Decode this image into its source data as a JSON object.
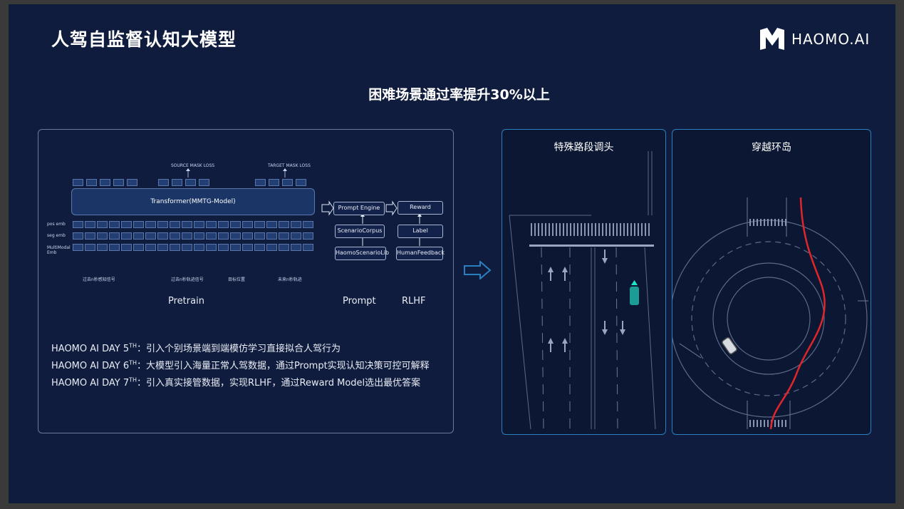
{
  "title": "人驾自监督认知大模型",
  "logo": {
    "text": "HAOMO.AI",
    "icon": "haomo-logo-icon"
  },
  "headline": "困难场景通过率提升30%以上",
  "diagram": {
    "source_mask_loss": "SOURCE MASK LOSS",
    "target_mask_loss": "TARGET MASK LOSS",
    "transformer": "Transformer(MMTG-Model)",
    "pos_emb": "pos emb",
    "seg_emb": "seg emb",
    "multimodal_emb": "MultiModal Emb",
    "group_past": "过去n秒感知信号",
    "group_traj": "过去n秒轨迹信号",
    "group_goal": "目标位置",
    "group_future": "未来n秒轨迹",
    "prompt_engine": "Prompt Engine",
    "scenario_corpus": "ScenarioCorpus",
    "scenario_lib": "HaomoScenarioLib",
    "reward": "Reward",
    "label": "Label",
    "human_feedback": "HumanFeedback",
    "pretrain": "Pretrain",
    "prompt": "Prompt",
    "rlhf": "RLHF"
  },
  "notes": [
    {
      "prefix": "HAOMO AI DAY 5",
      "sup": "TH",
      "text": "：引入个别场景端到端模仿学习直接拟合人驾行为"
    },
    {
      "prefix": "HAOMO AI DAY 6",
      "sup": "TH",
      "text": "：大模型引入海量正常人驾数据，通过Prompt实现认知决策可控可解释"
    },
    {
      "prefix": "HAOMO AI DAY 7",
      "sup": "TH",
      "text": "：引入真实接管数据，实现RLHF，通过Reward Model选出最优答案"
    }
  ],
  "panels": [
    {
      "title": "特殊路段调头"
    },
    {
      "title": "穿越环岛"
    }
  ],
  "colors": {
    "background": "#0f1c3d",
    "accent_blue": "#2a7fc0",
    "route_red": "#e0262a",
    "vehicle_teal": "#1fb5a8"
  }
}
